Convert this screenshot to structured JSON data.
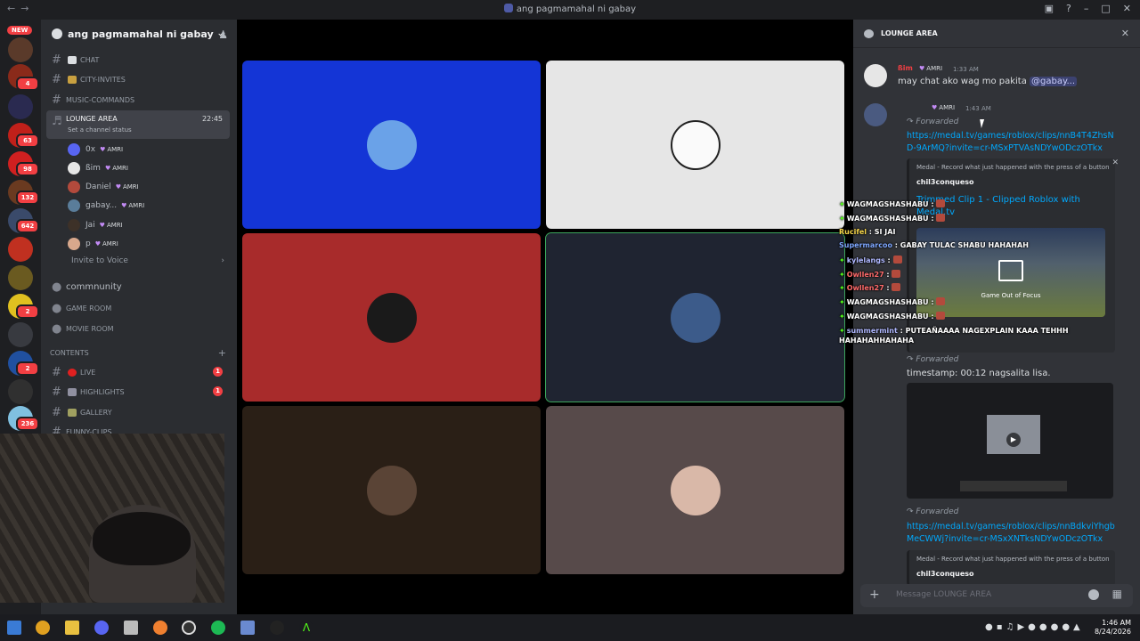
{
  "window": {
    "title": "ang pagmamahal ni gabay"
  },
  "rail": {
    "new_badge": "NEW",
    "badges": [
      "4",
      "63",
      "98",
      "132",
      "642",
      "2",
      "2",
      "236"
    ]
  },
  "sidebar": {
    "server_name": "ang pagmamahal ni gabay",
    "channels_top": [
      {
        "label": "CHAT"
      },
      {
        "label": "CITY-INVITES"
      },
      {
        "label": "MUSIC-COMMANDS"
      }
    ],
    "voice_channel": {
      "label": "LOUNGE AREA",
      "time": "22:45",
      "status": "Set a channel status"
    },
    "voice_users": [
      {
        "name": "0x",
        "tag": "AMRI",
        "color": "#5865f2"
      },
      {
        "name": "ßim",
        "tag": "AMRI",
        "color": "#e6e6e6"
      },
      {
        "name": "Daniel",
        "tag": "AMRI",
        "color": "#b34a3c"
      },
      {
        "name": "gabay...",
        "tag": "AMRI",
        "color": "#5a7d9a"
      },
      {
        "name": "Jai",
        "tag": "AMRI",
        "color": "#3d3128"
      },
      {
        "name": "p",
        "tag": "AMRI",
        "color": "#d8a88c"
      }
    ],
    "invite_label": "Invite to Voice",
    "other_voice": [
      {
        "label": "commnunity"
      },
      {
        "label": "GAME ROOM"
      },
      {
        "label": "MOVIE ROOM"
      }
    ],
    "category": "CONTENTS",
    "content_channels": [
      {
        "label": "LIVE",
        "count": "1"
      },
      {
        "label": "HIGHLIGHTS",
        "count": "1"
      },
      {
        "label": "GALLERY",
        "count": ""
      },
      {
        "label": "FUNNY-CLIPS",
        "count": ""
      }
    ]
  },
  "stage": {
    "tiles": [
      {
        "bg": "#1435d6",
        "avatar": "#6aa2e8"
      },
      {
        "bg": "#e6e6e6",
        "avatar": "#ffffff"
      },
      {
        "bg": "#a82b2b",
        "avatar": "#1a1a1a"
      },
      {
        "bg": "#1f2431",
        "avatar": "#3c5b8a"
      },
      {
        "bg": "#2a1f16",
        "avatar": "#5a4436"
      },
      {
        "bg": "#574a4a",
        "avatar": "#d9b8a8"
      }
    ]
  },
  "chat": {
    "header": "LOUNGE AREA",
    "msg1": {
      "user": "ßim",
      "tag": "AMRI",
      "time": "1:33 AM",
      "text": "may chat ako wag mo pakita ",
      "mention": "@gabay..."
    },
    "msg2": {
      "tag": "AMRI",
      "time": "1:43 AM",
      "forwarded": "Forwarded",
      "link": "https://medal.tv/games/roblox/clips/nnB4T4ZhsND-9ArMQ?invite=cr-MSxPTVAsNDYwODczOTkx",
      "embed_provider": "Medal - Record what just happened with the press of a button",
      "embed_author": "chil3conqueso",
      "embed_title": "Trimmed Clip 1 - Clipped Roblox with Medal.tv",
      "video_overlay": "Game Out of Focus"
    },
    "msg3": {
      "forwarded": "Forwarded",
      "text": "timestamp: 00:12 nagsalita lisa."
    },
    "msg4": {
      "forwarded": "Forwarded",
      "link": "https://medal.tv/games/roblox/clips/nnBdkviYhgbMeCWWj?invite=cr-MSxXNTksNDYwODczOTkx",
      "embed_provider": "Medal - Record what just happened with the press of a button",
      "embed_author": "chil3conqueso"
    },
    "input_placeholder": "Message LOUNGE AREA"
  },
  "overlay_chat": [
    {
      "user": "WAGMAGSHASHABU",
      "color": "#ffffff",
      "text": ""
    },
    {
      "user": "WAGMAGSHASHABU",
      "color": "#ffffff",
      "text": ""
    },
    {
      "user": "Rucifel",
      "color": "#f7d64a",
      "text": "SI JAI"
    },
    {
      "user": "Supermarcoo",
      "color": "#7ea7ff",
      "text": "GABAY TULAC SHABU HAHAHAH"
    },
    {
      "user": "kylelangs",
      "color": "#b0b8ff",
      "text": ""
    },
    {
      "user": "Owllen27",
      "color": "#ff6b6b",
      "text": ""
    },
    {
      "user": "Owllen27",
      "color": "#ff6b6b",
      "text": ""
    },
    {
      "user": "WAGMAGSHASHABU",
      "color": "#ffffff",
      "text": ""
    },
    {
      "user": "WAGMAGSHASHABU",
      "color": "#ffffff",
      "text": ""
    },
    {
      "user": "summermint",
      "color": "#b0b8ff",
      "text": "PUTEAÑAAAA NAGEXPLAIN KAAA TEHHH HAHAHAHHAHAHA"
    }
  ],
  "taskbar": {
    "time": "1:46 AM",
    "date": "8/24/2026"
  }
}
